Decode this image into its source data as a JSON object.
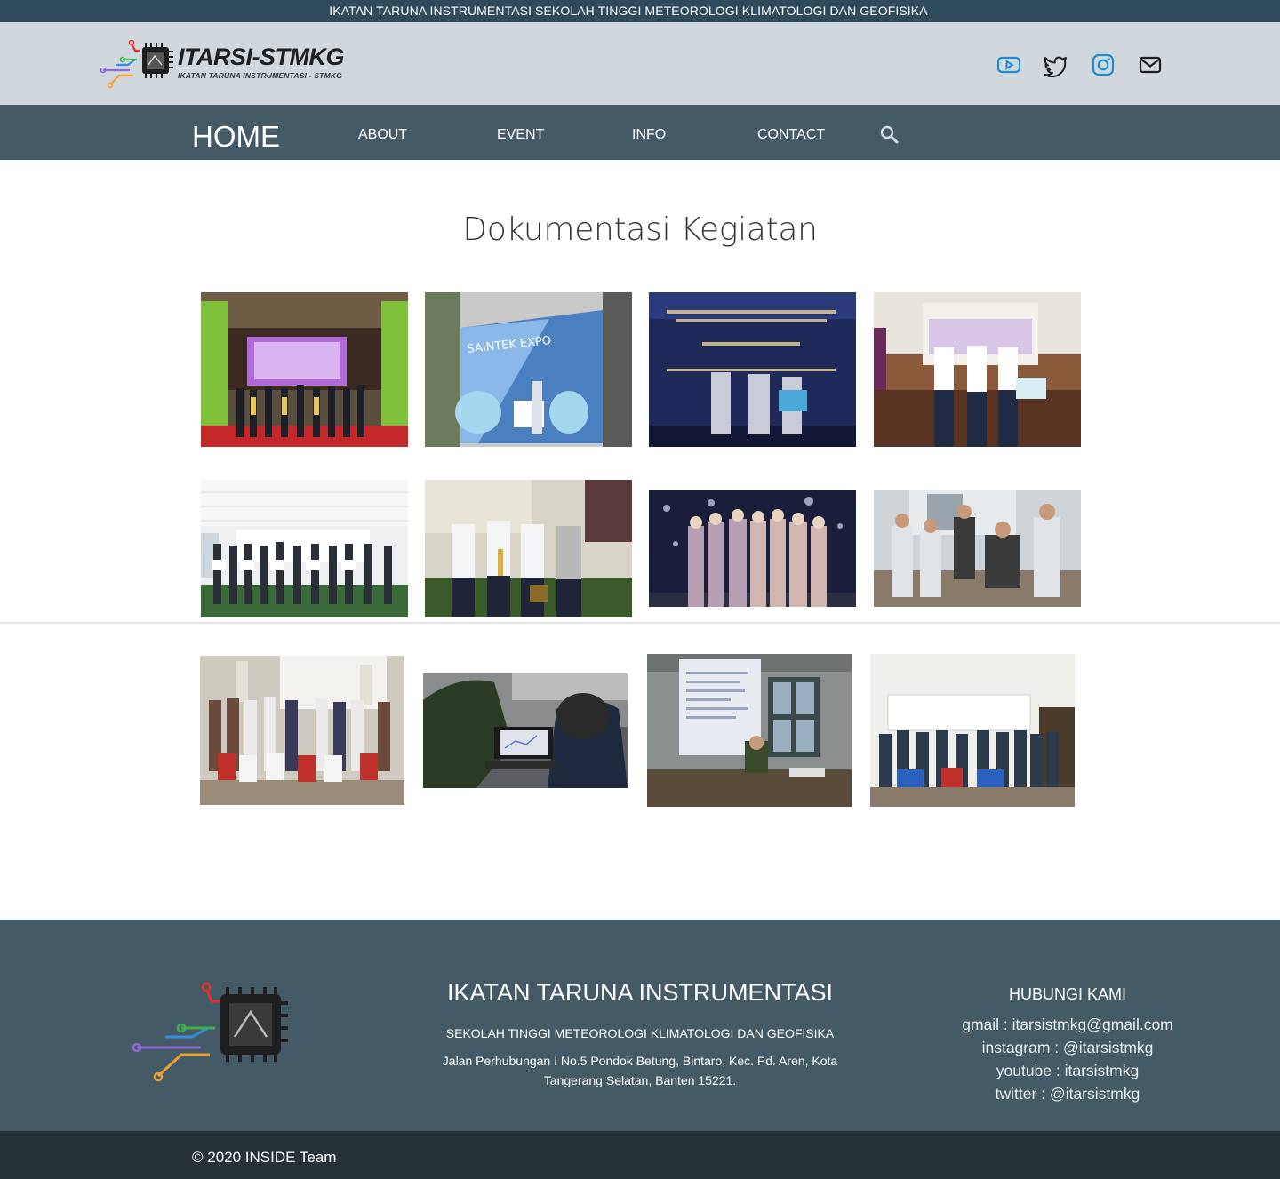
{
  "top_banner": {
    "text": "IKATAN TARUNA INSTRUMENTASI SEKOLAH TINGGI METEOROLOGI KLIMATOLOGI DAN GEOFISIKA"
  },
  "brand": {
    "name": "ITARSI-STMKG",
    "tagline": "IKATAN TARUNA INSTRUMENTASI - STMKG"
  },
  "social_icons": [
    "youtube-icon",
    "twitter-icon",
    "instagram-icon",
    "mail-icon"
  ],
  "nav": {
    "home": "HOME",
    "about": "ABOUT",
    "event": "EVENT",
    "info": "INFO",
    "contact": "CONTACT"
  },
  "gallery": {
    "title": "Dokumentasi Kegiatan",
    "photo_count": 12
  },
  "footer": {
    "title": "IKATAN TARUNA INSTRUMENTASI",
    "subtitle": "SEKOLAH TINGGI METEOROLOGI KLIMATOLOGI DAN GEOFISIKA",
    "address_line1": "Jalan Perhubungan I No.5 Pondok Betung, Bintaro, Kec. Pd. Aren, Kota",
    "address_line2": "Tangerang Selatan, Banten 15221.",
    "contact_title": "HUBUNGI KAMI",
    "gmail": "gmail : itarsistmkg@gmail.com",
    "instagram": "instagram : @itarsistmkg",
    "youtube": "youtube : itarsistmkg",
    "twitter": "twitter : @itarsistmkg"
  },
  "copyright": "© 2020 INSIDE Team",
  "colors": {
    "topbar": "#2f4a5b",
    "header": "#d0d8de",
    "nav": "#455a67",
    "footer": "#455a67",
    "bottombar": "#263238",
    "social_blue": "#1a8ed1"
  }
}
